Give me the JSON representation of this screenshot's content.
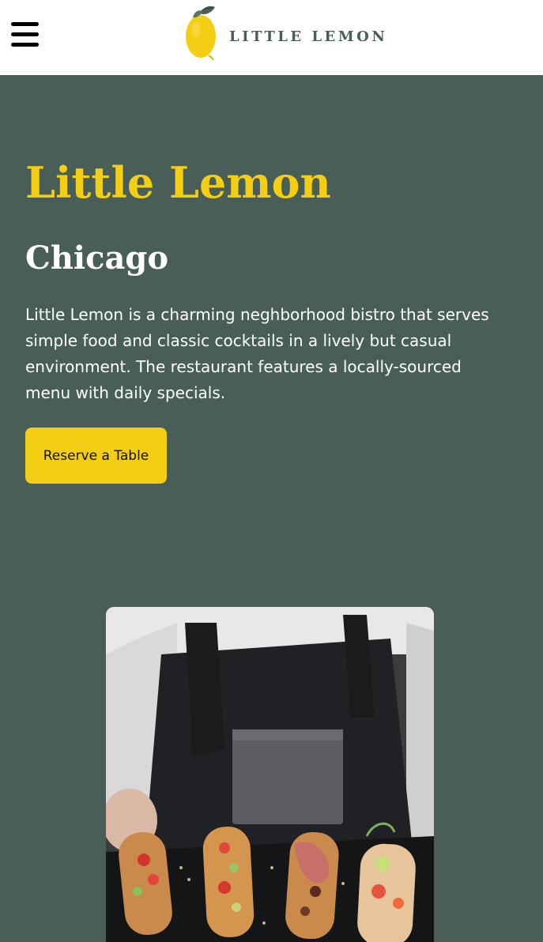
{
  "header": {
    "menu_icon": "hamburger-menu-icon",
    "logo_text": "LITTLE LEMON",
    "logo_icon": "lemon-icon"
  },
  "hero": {
    "title": "Little Lemon",
    "subtitle": "Chicago",
    "description": "Little Lemon is a charming neghborhood bistro that serves simple food and classic cocktails in a lively but casual environment. The restaurant features a locally-sourced menu with daily specials.",
    "reserve_button": "Reserve a Table",
    "image": "chef-holding-bruschetta-platter"
  },
  "colors": {
    "primary_green": "#495e57",
    "primary_yellow": "#f4ce14",
    "white": "#ffffff"
  }
}
